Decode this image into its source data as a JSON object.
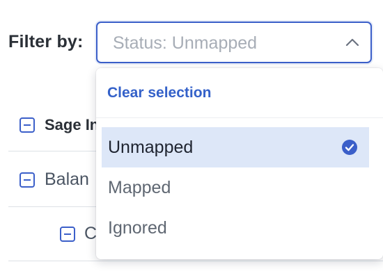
{
  "filter": {
    "label": "Filter by:",
    "value": "Status: Unmapped"
  },
  "table": {
    "header": "Sage In",
    "rows": [
      {
        "text": "Balan"
      },
      {
        "text": "C"
      }
    ]
  },
  "dropdown": {
    "clear_label": "Clear selection",
    "options": [
      {
        "label": "Unmapped",
        "selected": true
      },
      {
        "label": "Mapped",
        "selected": false
      },
      {
        "label": "Ignored",
        "selected": false
      }
    ]
  },
  "colors": {
    "accent": "#3b5fc9",
    "selected_bg": "#dde7f8",
    "link": "#3461c9"
  },
  "icons": {
    "select_chevron": "chevron-up-icon",
    "selected_check": "check-circle-icon",
    "tree_toggle": "minus-square-icon"
  }
}
